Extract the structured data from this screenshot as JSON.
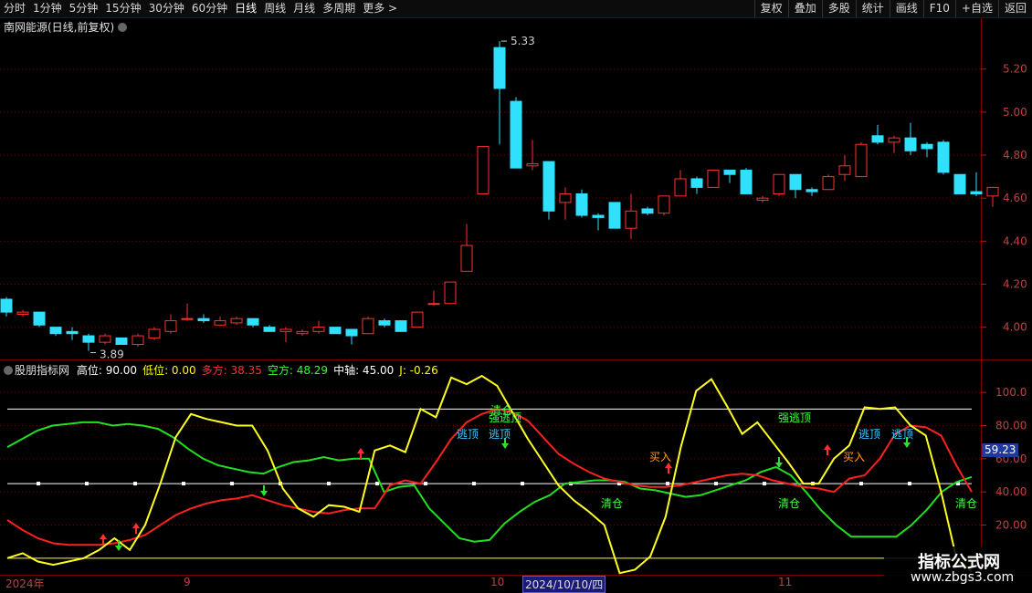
{
  "toolbar": {
    "left": [
      "分时",
      "1分钟",
      "5分钟",
      "15分钟",
      "30分钟",
      "60分钟",
      "日线",
      "周线",
      "月线",
      "多周期",
      "更多 >"
    ],
    "right": [
      "复权",
      "叠加",
      "多股",
      "统计",
      "画线",
      "F10",
      "+自选",
      "返回"
    ]
  },
  "main_title": "南网能源(日线,前复权)",
  "price_axis": [
    "5.20",
    "5.00",
    "4.80",
    "4.60",
    "4.40",
    "4.20",
    "4.00"
  ],
  "price_labels": {
    "high": "5.33",
    "low": "3.89"
  },
  "indicator": {
    "name": "股朋指标网",
    "items": [
      {
        "label": "高位: 90.00",
        "color": "#ffffff"
      },
      {
        "label": "低位: 0.00",
        "color": "#ffff00"
      },
      {
        "label": "多方: 38.35",
        "color": "#ff3030"
      },
      {
        "label": "空方: 48.29",
        "color": "#30ff30"
      },
      {
        "label": "中轴: 45.00",
        "color": "#ffffff"
      },
      {
        "label": "J: -0.26",
        "color": "#ffff00"
      }
    ]
  },
  "ind_axis": [
    "100.0",
    "80.00",
    "60.00",
    "40.00",
    "20.00"
  ],
  "current_value": "59.23",
  "annotations": [
    {
      "text": "逃顶",
      "color": "#40c8ff"
    },
    {
      "text": "逃顶",
      "color": "#40c8ff"
    },
    {
      "text": "强逃顶",
      "color": "#40ff40"
    },
    {
      "text": "清仓",
      "color": "#40ff40"
    },
    {
      "text": "清仓",
      "color": "#40ff40"
    },
    {
      "text": "清仓",
      "color": "#40ff40"
    },
    {
      "text": "买入",
      "color": "#ffa000"
    },
    {
      "text": "买入",
      "color": "#ffa000"
    },
    {
      "text": "强逃顶",
      "color": "#40ff40"
    },
    {
      "text": "逃顶",
      "color": "#40c8ff"
    },
    {
      "text": "逃顶",
      "color": "#40c8ff"
    }
  ],
  "date_axis": {
    "labels": [
      "2024年",
      "9",
      "10",
      "11"
    ],
    "selected": "2024/10/10/四"
  },
  "watermark": {
    "line1": "指标公式网",
    "line2": "www.zbgs3.com"
  },
  "colors": {
    "up": "#ff3030",
    "down": "#30e0ff",
    "grid": "#7a0000",
    "bull": "#ff2020",
    "bear": "#20e020",
    "j": "#ffff20"
  },
  "chart_data": {
    "type": "candlestick",
    "ylim": [
      3.85,
      5.36
    ],
    "candles": [
      {
        "o": 4.13,
        "c": 4.07,
        "h": 4.14,
        "l": 4.05
      },
      {
        "o": 4.06,
        "c": 4.07,
        "h": 4.08,
        "l": 4.05
      },
      {
        "o": 4.07,
        "c": 4.01,
        "h": 4.07,
        "l": 4.0
      },
      {
        "o": 4.0,
        "c": 3.97,
        "h": 4.0,
        "l": 3.96
      },
      {
        "o": 3.98,
        "c": 3.97,
        "h": 4.0,
        "l": 3.94
      },
      {
        "o": 3.96,
        "c": 3.93,
        "h": 3.97,
        "l": 3.89
      },
      {
        "o": 3.93,
        "c": 3.96,
        "h": 3.97,
        "l": 3.92
      },
      {
        "o": 3.95,
        "c": 3.92,
        "h": 3.95,
        "l": 3.92
      },
      {
        "o": 3.92,
        "c": 3.96,
        "h": 3.97,
        "l": 3.91
      },
      {
        "o": 3.95,
        "c": 3.99,
        "h": 4.0,
        "l": 3.94
      },
      {
        "o": 3.98,
        "c": 4.03,
        "h": 4.06,
        "l": 3.97
      },
      {
        "o": 4.04,
        "c": 4.04,
        "h": 4.11,
        "l": 4.03
      },
      {
        "o": 4.04,
        "c": 4.03,
        "h": 4.06,
        "l": 4.02
      },
      {
        "o": 4.01,
        "c": 4.03,
        "h": 4.05,
        "l": 4.01
      },
      {
        "o": 4.02,
        "c": 4.04,
        "h": 4.05,
        "l": 4.01
      },
      {
        "o": 4.04,
        "c": 4.01,
        "h": 4.04,
        "l": 4.0
      },
      {
        "o": 4.0,
        "c": 3.98,
        "h": 4.01,
        "l": 3.98
      },
      {
        "o": 3.98,
        "c": 3.99,
        "h": 4.0,
        "l": 3.93
      },
      {
        "o": 3.97,
        "c": 3.98,
        "h": 3.99,
        "l": 3.96
      },
      {
        "o": 3.98,
        "c": 4.0,
        "h": 4.03,
        "l": 3.97
      },
      {
        "o": 4.0,
        "c": 3.97,
        "h": 4.0,
        "l": 3.97
      },
      {
        "o": 3.99,
        "c": 3.96,
        "h": 3.99,
        "l": 3.92
      },
      {
        "o": 3.97,
        "c": 4.04,
        "h": 4.05,
        "l": 3.97
      },
      {
        "o": 4.03,
        "c": 4.01,
        "h": 4.04,
        "l": 4.0
      },
      {
        "o": 4.03,
        "c": 3.98,
        "h": 4.03,
        "l": 3.98
      },
      {
        "o": 4.0,
        "c": 4.07,
        "h": 4.07,
        "l": 4.0
      },
      {
        "o": 4.11,
        "c": 4.11,
        "h": 4.17,
        "l": 4.1
      },
      {
        "o": 4.11,
        "c": 4.21,
        "h": 4.21,
        "l": 4.11
      },
      {
        "o": 4.26,
        "c": 4.38,
        "h": 4.48,
        "l": 4.26
      },
      {
        "o": 4.62,
        "c": 4.84,
        "h": 4.84,
        "l": 4.62
      },
      {
        "o": 5.3,
        "c": 5.11,
        "h": 5.33,
        "l": 4.85
      },
      {
        "o": 5.05,
        "c": 4.74,
        "h": 5.07,
        "l": 4.74
      },
      {
        "o": 4.75,
        "c": 4.76,
        "h": 4.87,
        "l": 4.73
      },
      {
        "o": 4.77,
        "c": 4.54,
        "h": 4.77,
        "l": 4.5
      },
      {
        "o": 4.58,
        "c": 4.62,
        "h": 4.65,
        "l": 4.5
      },
      {
        "o": 4.62,
        "c": 4.52,
        "h": 4.64,
        "l": 4.51
      },
      {
        "o": 4.52,
        "c": 4.51,
        "h": 4.53,
        "l": 4.45
      },
      {
        "o": 4.58,
        "c": 4.46,
        "h": 4.58,
        "l": 4.46
      },
      {
        "o": 4.46,
        "c": 4.54,
        "h": 4.62,
        "l": 4.41
      },
      {
        "o": 4.55,
        "c": 4.53,
        "h": 4.56,
        "l": 4.52
      },
      {
        "o": 4.53,
        "c": 4.61,
        "h": 4.61,
        "l": 4.52
      },
      {
        "o": 4.61,
        "c": 4.69,
        "h": 4.73,
        "l": 4.61
      },
      {
        "o": 4.69,
        "c": 4.65,
        "h": 4.7,
        "l": 4.62
      },
      {
        "o": 4.65,
        "c": 4.73,
        "h": 4.73,
        "l": 4.65
      },
      {
        "o": 4.73,
        "c": 4.71,
        "h": 4.73,
        "l": 4.67
      },
      {
        "o": 4.73,
        "c": 4.62,
        "h": 4.74,
        "l": 4.62
      },
      {
        "o": 4.59,
        "c": 4.6,
        "h": 4.61,
        "l": 4.58
      },
      {
        "o": 4.62,
        "c": 4.71,
        "h": 4.71,
        "l": 4.61
      },
      {
        "o": 4.71,
        "c": 4.64,
        "h": 4.71,
        "l": 4.6
      },
      {
        "o": 4.64,
        "c": 4.63,
        "h": 4.65,
        "l": 4.61
      },
      {
        "o": 4.64,
        "c": 4.7,
        "h": 4.71,
        "l": 4.64
      },
      {
        "o": 4.71,
        "c": 4.75,
        "h": 4.8,
        "l": 4.68
      },
      {
        "o": 4.7,
        "c": 4.85,
        "h": 4.86,
        "l": 4.7
      },
      {
        "o": 4.89,
        "c": 4.86,
        "h": 4.94,
        "l": 4.85
      },
      {
        "o": 4.86,
        "c": 4.88,
        "h": 4.89,
        "l": 4.81
      },
      {
        "o": 4.88,
        "c": 4.82,
        "h": 4.95,
        "l": 4.8
      },
      {
        "o": 4.85,
        "c": 4.83,
        "h": 4.86,
        "l": 4.79
      },
      {
        "o": 4.86,
        "c": 4.72,
        "h": 4.87,
        "l": 4.71
      },
      {
        "o": 4.71,
        "c": 4.62,
        "h": 4.71,
        "l": 4.62
      },
      {
        "o": 4.63,
        "c": 4.62,
        "h": 4.72,
        "l": 4.61
      },
      {
        "o": 4.61,
        "c": 4.65,
        "h": 4.65,
        "l": 4.56
      }
    ],
    "indicator": {
      "ylim": [
        -10,
        110
      ],
      "bull": [
        23,
        17,
        12,
        9,
        8,
        8,
        8,
        9,
        11,
        14,
        20,
        26,
        30,
        33,
        35,
        36,
        38,
        35,
        32,
        30,
        28,
        27,
        29,
        30,
        30,
        44,
        47,
        45,
        58,
        72,
        82,
        87,
        90,
        88,
        83,
        73,
        63,
        57,
        52,
        48,
        46,
        44,
        43,
        43,
        44,
        46,
        48,
        50,
        51,
        50,
        47,
        45,
        43,
        42,
        40,
        48,
        50,
        60,
        75,
        80,
        79,
        74,
        56,
        40
      ],
      "bear": [
        67,
        72,
        77,
        80,
        81,
        82,
        82,
        80,
        81,
        80,
        78,
        73,
        66,
        60,
        56,
        54,
        52,
        51,
        55,
        58,
        59,
        61,
        59,
        60,
        60,
        40,
        43,
        44,
        30,
        21,
        12,
        10,
        11,
        21,
        28,
        34,
        38,
        45,
        46,
        47,
        47,
        46,
        42,
        41,
        39,
        37,
        38,
        41,
        44,
        47,
        52,
        55,
        50,
        40,
        29,
        20,
        13,
        13,
        13,
        13,
        20,
        29,
        40,
        46,
        49
      ],
      "j": [
        0,
        3,
        -2,
        -4,
        -2,
        0,
        5,
        12,
        5,
        20,
        45,
        73,
        87,
        84,
        82,
        80,
        80,
        65,
        42,
        30,
        25,
        32,
        31,
        28,
        65,
        68,
        64,
        90,
        85,
        109,
        105,
        110,
        104,
        88,
        72,
        58,
        44,
        35,
        28,
        20,
        -9,
        -7,
        1,
        25,
        67,
        101,
        108,
        92,
        75,
        82,
        70,
        58,
        45,
        45,
        60,
        68,
        91,
        90,
        91,
        80,
        74,
        40,
        0,
        -8
      ]
    }
  }
}
